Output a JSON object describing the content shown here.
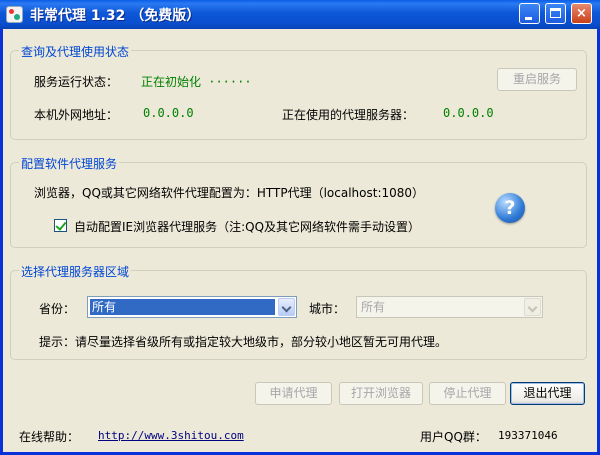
{
  "window": {
    "title": "非常代理 1.32 （免费版）",
    "controls": {
      "minimize": "",
      "maximize": "",
      "close": "×"
    }
  },
  "status_group": {
    "legend": "查询及代理使用状态",
    "service_status_label": "服务运行状态：",
    "service_status_value": "正在初始化 ······",
    "restart_button": "重启服务",
    "external_ip_label": "本机外网地址：",
    "external_ip_value": "0.0.0.0",
    "proxy_in_use_label": "正在使用的代理服务器：",
    "proxy_in_use_value": "0.0.0.0"
  },
  "config_group": {
    "legend": "配置软件代理服务",
    "description": "浏览器，QQ或其它网络软件代理配置为：HTTP代理（localhost:1080）",
    "auto_config_checked": true,
    "auto_config_label": "自动配置IE浏览器代理服务（注:QQ及其它网络软件需手动设置）",
    "help_icon": "?"
  },
  "region_group": {
    "legend": "选择代理服务器区域",
    "province_label": "省份：",
    "province_value": "所有",
    "city_label": "城市：",
    "city_value": "所有",
    "hint": "提示：请尽量选择省级所有或指定较大地级市，部分较小地区暂无可用代理。"
  },
  "actions": {
    "apply_proxy": "申请代理",
    "open_browser": "打开浏览器",
    "stop_proxy": "停止代理",
    "exit_proxy": "退出代理"
  },
  "footer": {
    "online_help_label": "在线帮助：",
    "online_help_url": "http://www.3shitou.com",
    "qq_group_label": "用户QQ群：",
    "qq_group_value": "193371046"
  }
}
